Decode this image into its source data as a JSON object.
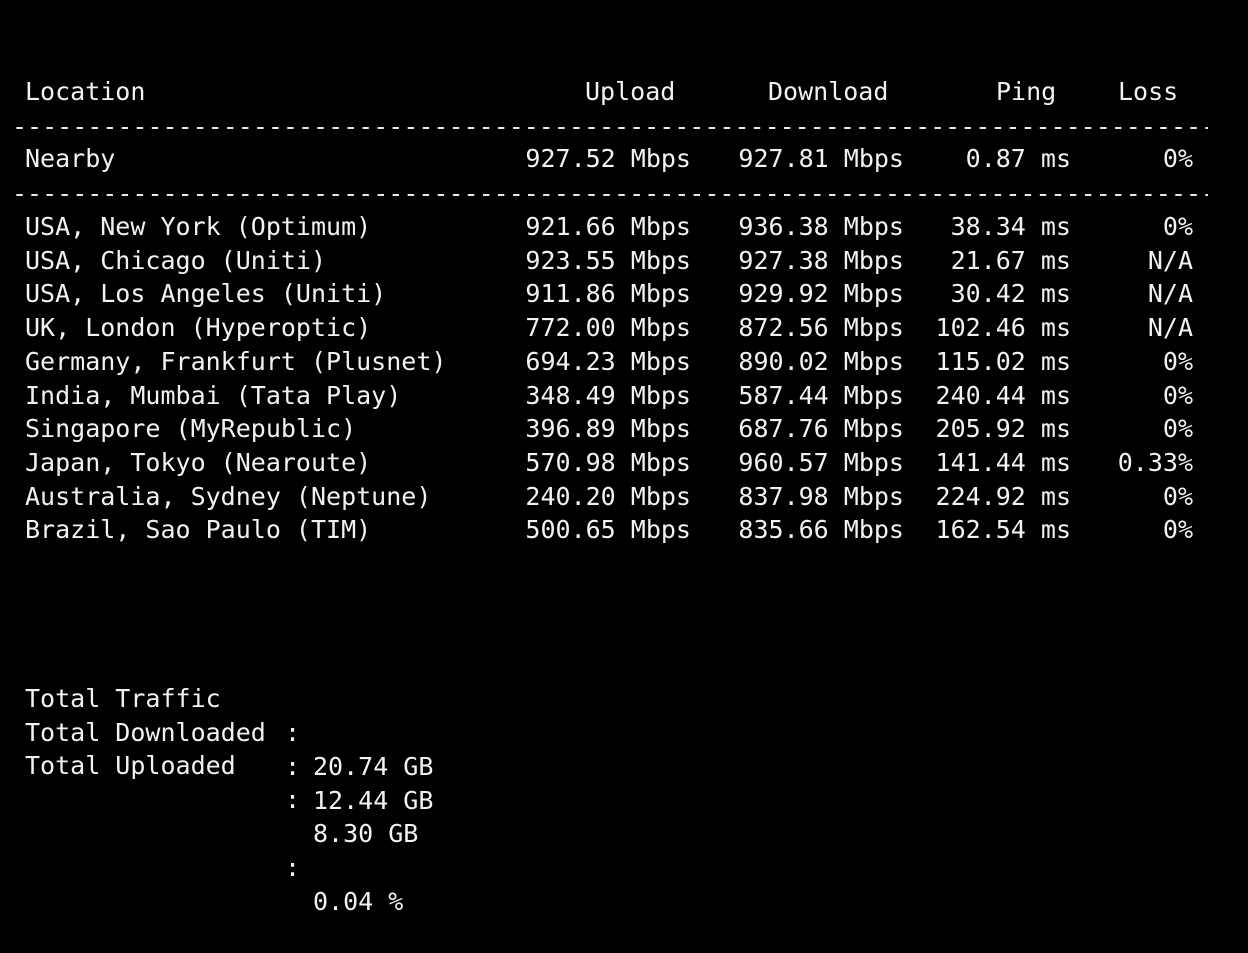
{
  "headers": {
    "location": "Location",
    "upload": "Upload",
    "download": "Download",
    "ping": "Ping",
    "loss": "Loss"
  },
  "divider": "--------------------------------------------------------------------------------------------------------------",
  "nearby": {
    "location": "Nearby",
    "upload": "927.52 Mbps",
    "download": "927.81 Mbps",
    "ping": "0.87 ms",
    "loss": "0%"
  },
  "rows": [
    {
      "location": "USA, New York (Optimum)",
      "upload": "921.66 Mbps",
      "download": "936.38 Mbps",
      "ping": "38.34 ms",
      "loss": "0%"
    },
    {
      "location": "USA, Chicago (Uniti)",
      "upload": "923.55 Mbps",
      "download": "927.38 Mbps",
      "ping": "21.67 ms",
      "loss": "N/A"
    },
    {
      "location": "USA, Los Angeles (Uniti)",
      "upload": "911.86 Mbps",
      "download": "929.92 Mbps",
      "ping": "30.42 ms",
      "loss": "N/A"
    },
    {
      "location": "UK, London (Hyperoptic)",
      "upload": "772.00 Mbps",
      "download": "872.56 Mbps",
      "ping": "102.46 ms",
      "loss": "N/A"
    },
    {
      "location": "Germany, Frankfurt (Plusnet)",
      "upload": "694.23 Mbps",
      "download": "890.02 Mbps",
      "ping": "115.02 ms",
      "loss": "0%"
    },
    {
      "location": "India, Mumbai (Tata Play)",
      "upload": "348.49 Mbps",
      "download": "587.44 Mbps",
      "ping": "240.44 ms",
      "loss": "0%"
    },
    {
      "location": "Singapore (MyRepublic)",
      "upload": "396.89 Mbps",
      "download": "687.76 Mbps",
      "ping": "205.92 ms",
      "loss": "0%"
    },
    {
      "location": "Japan, Tokyo (Nearoute)",
      "upload": "570.98 Mbps",
      "download": "960.57 Mbps",
      "ping": "141.44 ms",
      "loss": "0.33%"
    },
    {
      "location": "Australia, Sydney (Neptune)",
      "upload": "240.20 Mbps",
      "download": "837.98 Mbps",
      "ping": "224.92 ms",
      "loss": "0%"
    },
    {
      "location": "Brazil, Sao Paulo (TIM)",
      "upload": "500.65 Mbps",
      "download": "835.66 Mbps",
      "ping": "162.54 ms",
      "loss": "0%"
    }
  ],
  "summary": [
    {
      "label": "Total Traffic",
      "colon": ":",
      "value": "20.74 GB"
    },
    {
      "label": "Total Downloaded",
      "colon": ":",
      "value": "12.44 GB"
    },
    {
      "label": "Total Uploaded",
      "colon": ":",
      "value": "8.30 GB"
    },
    {
      "label": "",
      "colon": ":",
      "value": "0.04 %"
    }
  ]
}
